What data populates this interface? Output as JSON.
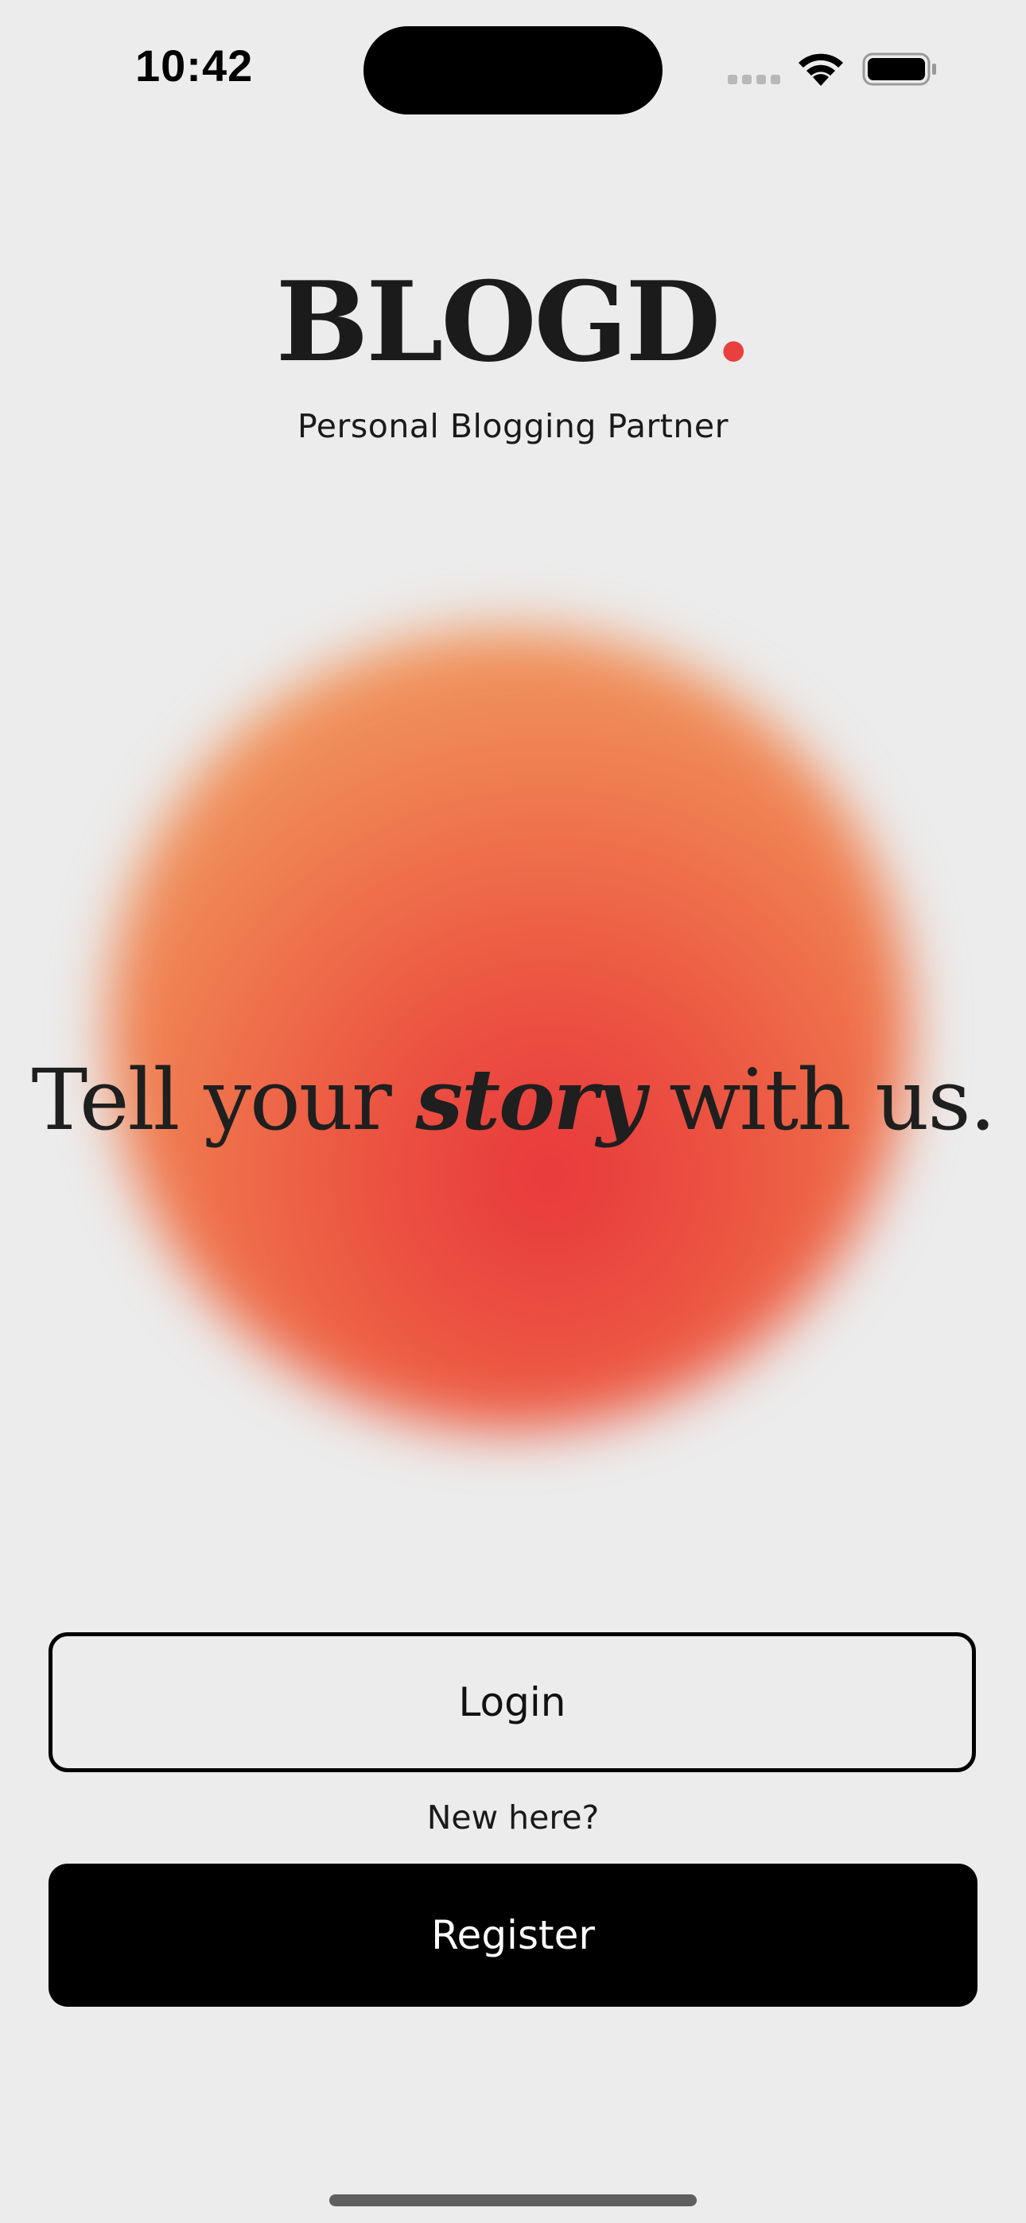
{
  "status_bar": {
    "time": "10:42"
  },
  "brand": {
    "name": "BLOGD",
    "dot": ".",
    "tagline": "Personal Blogging Partner",
    "accent_color": "#e8403f"
  },
  "hero": {
    "headline_before": "Tell your ",
    "headline_emphasis": "story",
    "headline_after": " with us.",
    "orb_colors": [
      "#e8383c",
      "#ec5642",
      "#ef7a4e",
      "#f09860",
      "#f2aa75"
    ]
  },
  "actions": {
    "login_label": "Login",
    "new_here_label": "New here?",
    "register_label": "Register"
  },
  "icons": {
    "signal": "cellular-signal-icon",
    "wifi": "wifi-icon",
    "battery": "battery-icon"
  }
}
